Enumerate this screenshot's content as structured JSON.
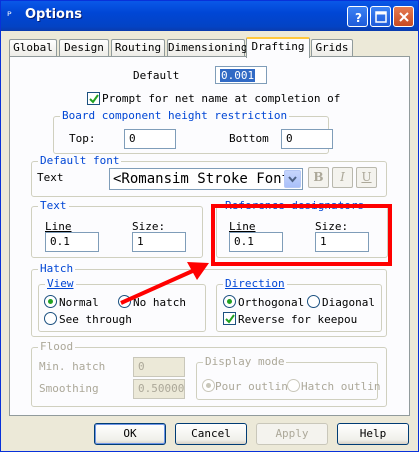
{
  "window": {
    "title": "Options"
  },
  "tabs": [
    "Global",
    "Design",
    "Routing",
    "Dimensioning",
    "Drafting",
    "Grids"
  ],
  "drafting": {
    "default_label": "Default",
    "default_value": "0.001",
    "prompt_label": "Prompt for net name at completion of",
    "board_group": {
      "title": "Board component height restriction",
      "top_label": "Top:",
      "top_value": "0",
      "bottom_label": "Bottom",
      "bottom_value": "0"
    },
    "font_group": {
      "title": "Default font",
      "text_label": "Text",
      "font_value": "<Romansim Stroke Font>",
      "bold": "B",
      "italic": "I",
      "underline": "U"
    },
    "text_group": {
      "title": "Text",
      "line_label": "Line",
      "line_value": "0.1",
      "size_label": "Size:",
      "size_value": "1"
    },
    "refdes_group": {
      "title": "Reference designators",
      "line_label": "Line",
      "line_value": "0.1",
      "size_label": "Size:",
      "size_value": "1"
    },
    "hatch_group": {
      "title": "Hatch",
      "view_title": "View",
      "normal": "Normal",
      "no_hatch": "No hatch",
      "see_through": "See through",
      "direction_title": "Direction",
      "orthogonal": "Orthogonal",
      "diagonal": "Diagonal",
      "reverse": "Reverse for keepou"
    },
    "flood_group": {
      "title": "Flood",
      "min_hatch_label": "Min. hatch",
      "min_hatch_value": "0",
      "smoothing_label": "Smoothing",
      "smoothing_value": "0.500000",
      "display_mode_title": "Display mode",
      "pour_outline": "Pour outlin",
      "hatch_outline": "Hatch outlin"
    }
  },
  "buttons": {
    "ok": "OK",
    "cancel": "Cancel",
    "apply": "Apply",
    "help": "Help"
  },
  "colors": {
    "annotation": "#FF0000",
    "title_bar": "#0A58E8",
    "group_title": "#0046D5"
  }
}
